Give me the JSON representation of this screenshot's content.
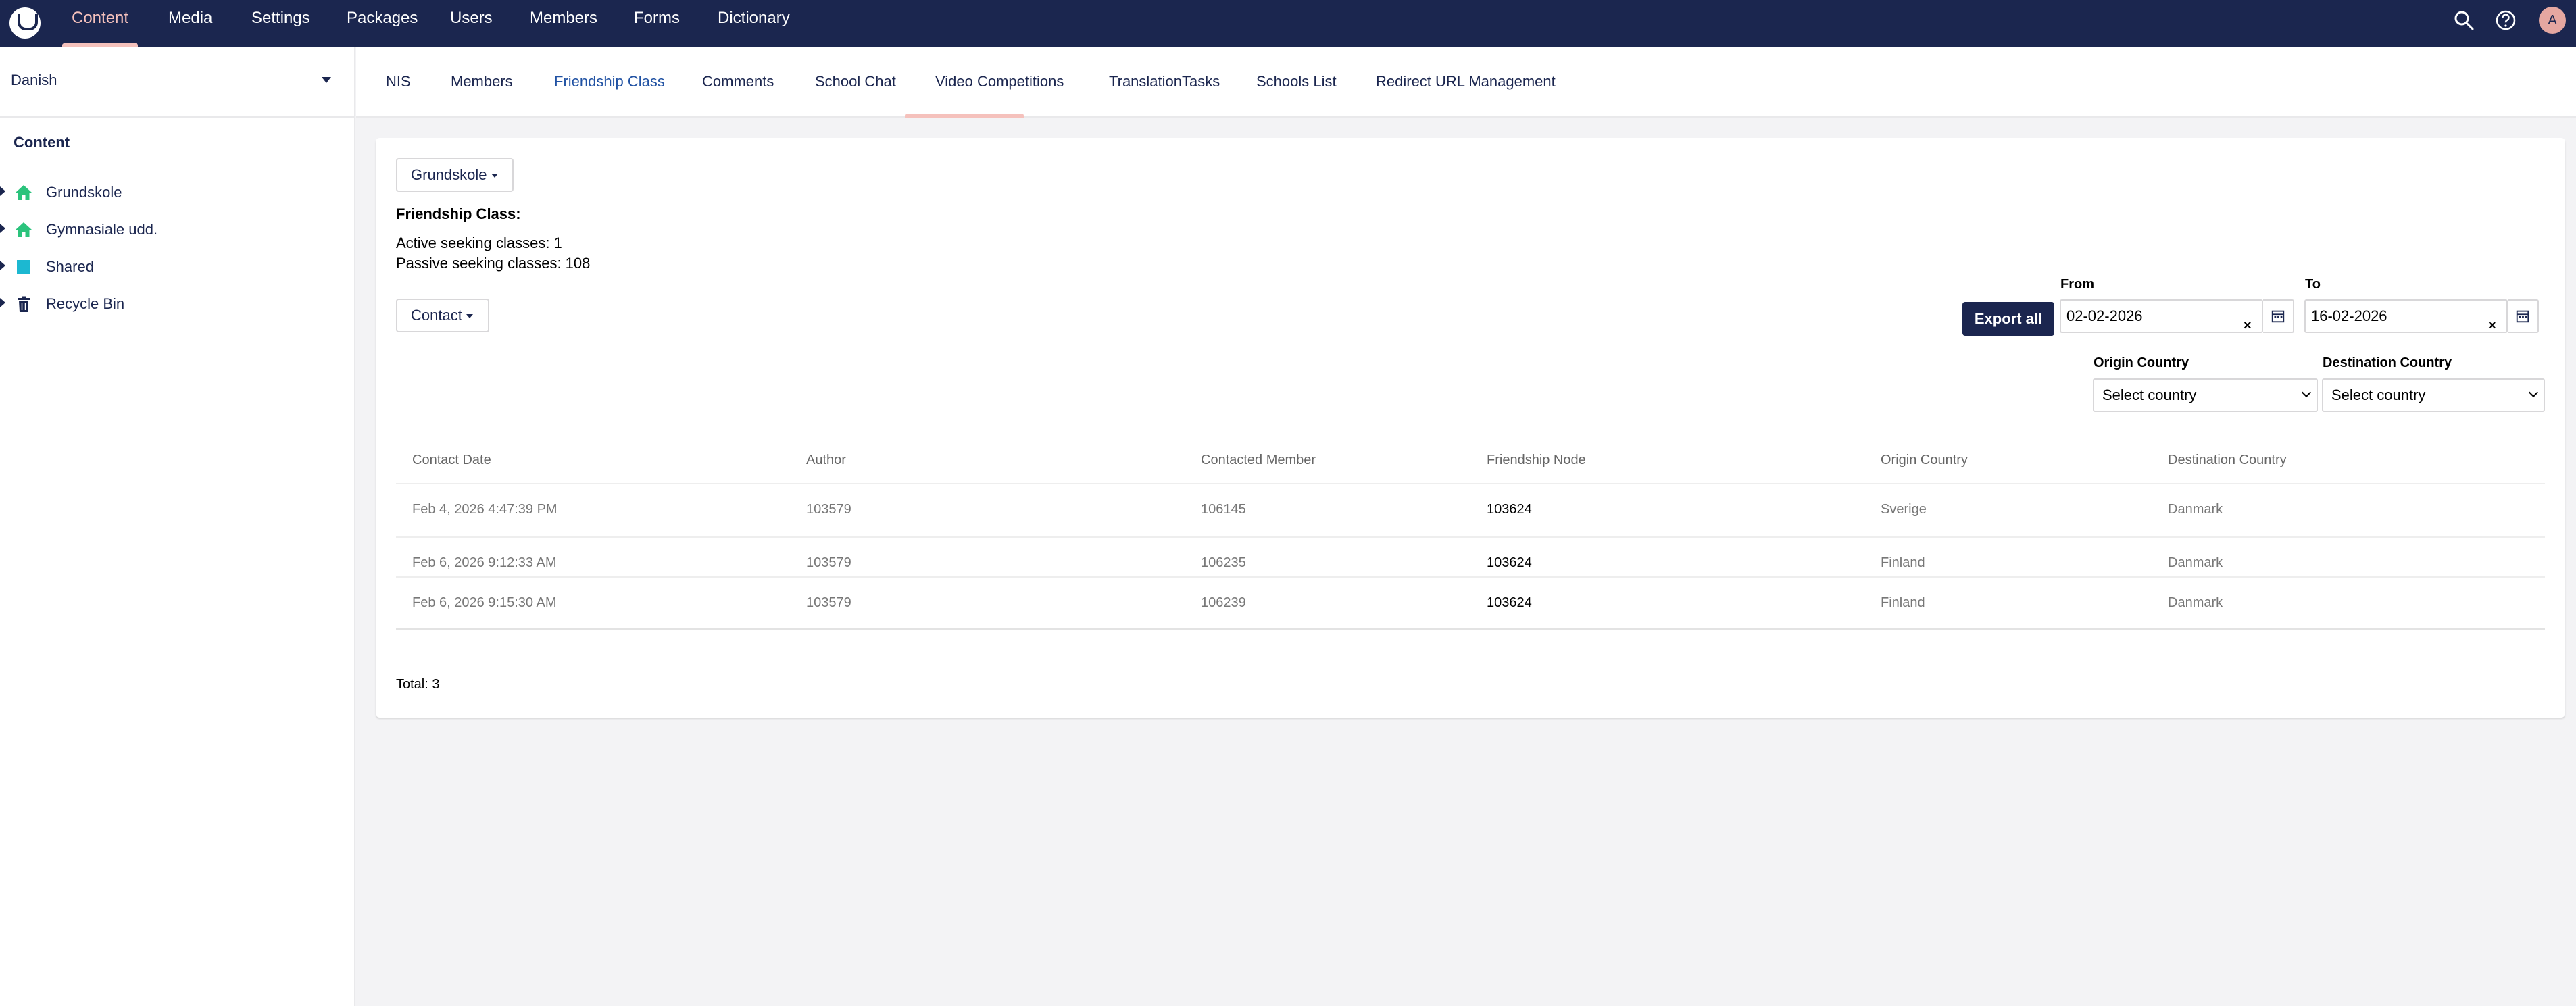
{
  "topnav": {
    "items": [
      "Content",
      "Media",
      "Settings",
      "Packages",
      "Users",
      "Members",
      "Forms",
      "Dictionary"
    ],
    "active": "Content",
    "avatar_initial": "A"
  },
  "sidebar": {
    "language": "Danish",
    "tree_heading": "Content",
    "items": [
      {
        "label": "Grundskole",
        "icon": "home-icon",
        "color": "#2bc37c"
      },
      {
        "label": "Gymnasiale udd.",
        "icon": "home-icon",
        "color": "#2bc37c"
      },
      {
        "label": "Shared",
        "icon": "square-icon",
        "color": "#1cb8d1"
      },
      {
        "label": "Recycle Bin",
        "icon": "trash-icon",
        "color": "#1b264f"
      }
    ]
  },
  "subtabs": {
    "items": [
      "NIS",
      "Members",
      "Friendship Class",
      "Comments",
      "School Chat",
      "Video Competitions",
      "TranslationTasks",
      "Schools List",
      "Redirect URL Management"
    ],
    "active": "Friendship Class"
  },
  "panel": {
    "school_dropdown": "Grundskole",
    "heading": "Friendship Class:",
    "active_seeking": "Active seeking classes: 1",
    "passive_seeking": "Passive seeking classes: 108",
    "contact_dropdown": "Contact",
    "export_label": "Export all",
    "from_label": "From",
    "from_value": "02-02-2026",
    "to_label": "To",
    "to_value": "16-02-2026",
    "origin_label": "Origin Country",
    "origin_value": "Select country",
    "destination_label": "Destination Country",
    "destination_value": "Select country",
    "total": "Total: 3"
  },
  "table": {
    "headers": [
      "Contact Date",
      "Author",
      "Contacted Member",
      "Friendship Node",
      "Origin Country",
      "Destination Country"
    ],
    "rows": [
      [
        "Feb 4, 2026 4:47:39 PM",
        "103579",
        "106145",
        "103624",
        "Sverige",
        "Danmark"
      ],
      [
        "Feb 6, 2026 9:12:33 AM",
        "103579",
        "106235",
        "103624",
        "Finland",
        "Danmark"
      ],
      [
        "Feb 6, 2026 9:15:30 AM",
        "103579",
        "106239",
        "103624",
        "Finland",
        "Danmark"
      ]
    ]
  },
  "colors": {
    "header_bg": "#1b264f",
    "accent": "#f5c1bc",
    "active_tab": "#2152a3"
  }
}
